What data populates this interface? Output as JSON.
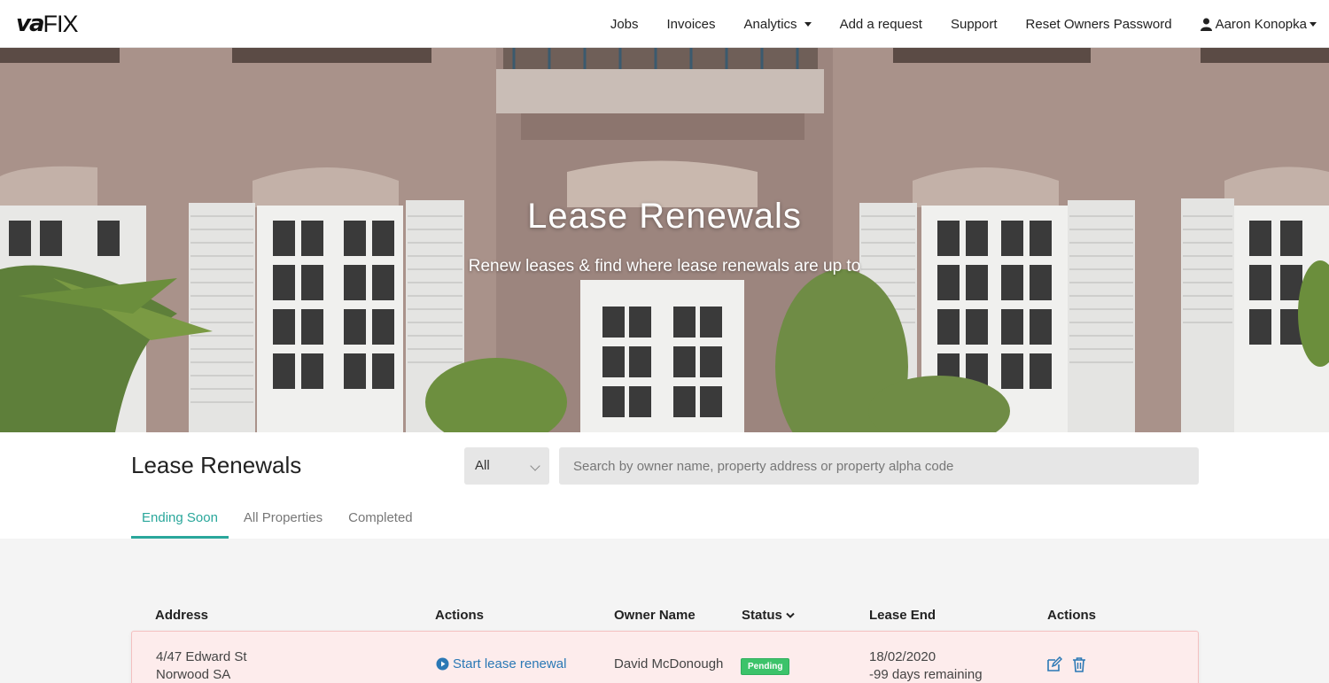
{
  "brand": {
    "logo_va": "va",
    "logo_fix": "FIX"
  },
  "nav": {
    "items": [
      {
        "label": "Jobs"
      },
      {
        "label": "Invoices"
      },
      {
        "label": "Analytics"
      },
      {
        "label": "Add a request"
      },
      {
        "label": "Support"
      },
      {
        "label": "Reset Owners Password"
      }
    ],
    "user_name": "Aaron Konopka"
  },
  "hero": {
    "title": "Lease Renewals",
    "subtitle": "Renew leases & find where lease renewals are up to"
  },
  "main": {
    "heading": "Lease Renewals",
    "filter_value": "All",
    "search_placeholder": "Search by owner name, property address or property alpha code",
    "tabs": [
      {
        "label": "Ending Soon",
        "active": true
      },
      {
        "label": "All Properties",
        "active": false
      },
      {
        "label": "Completed",
        "active": false
      }
    ]
  },
  "table": {
    "headers": {
      "address": "Address",
      "actions": "Actions",
      "owner": "Owner Name",
      "status": "Status",
      "lease_end": "Lease End",
      "actions2": "Actions"
    },
    "rows": [
      {
        "address_line1": "4/47 Edward St",
        "address_line2": "Norwood SA",
        "action_label": "Start lease renewal",
        "owner": "David McDonough",
        "status": "Pending",
        "lease_end_date": "18/02/2020",
        "lease_remaining": "-99 days remaining"
      }
    ]
  },
  "colors": {
    "accent": "#2aa79b",
    "link": "#2a78b5",
    "status_pending": "#3cc36a",
    "row_highlight": "#fdecec"
  },
  "icons": [
    "user-icon",
    "caret-down-icon",
    "chevron-down-icon",
    "sort-chevron-icon",
    "play-circle-icon",
    "edit-icon",
    "trash-icon"
  ]
}
